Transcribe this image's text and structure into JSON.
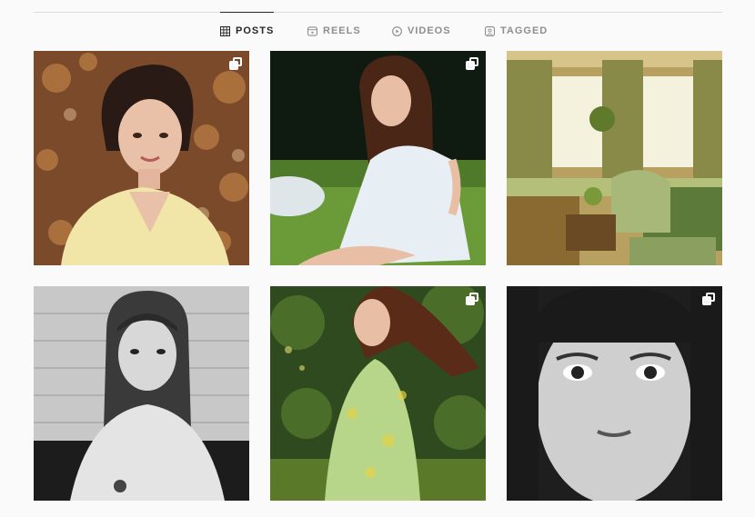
{
  "tabs": [
    {
      "label": "POSTS",
      "icon": "grid-icon",
      "active": true
    },
    {
      "label": "REELS",
      "icon": "reels-icon",
      "active": false
    },
    {
      "label": "VIDEOS",
      "icon": "play-icon",
      "active": false
    },
    {
      "label": "TAGGED",
      "icon": "tag-icon",
      "active": false
    }
  ],
  "posts": [
    {
      "multiple": true
    },
    {
      "multiple": true
    },
    {
      "multiple": false
    },
    {
      "multiple": false
    },
    {
      "multiple": true
    },
    {
      "multiple": true
    }
  ],
  "colors": {
    "active_tab": "#262626",
    "inactive_tab": "#8e8e8e",
    "divider": "#dbdbdb",
    "background": "#fafafa"
  }
}
